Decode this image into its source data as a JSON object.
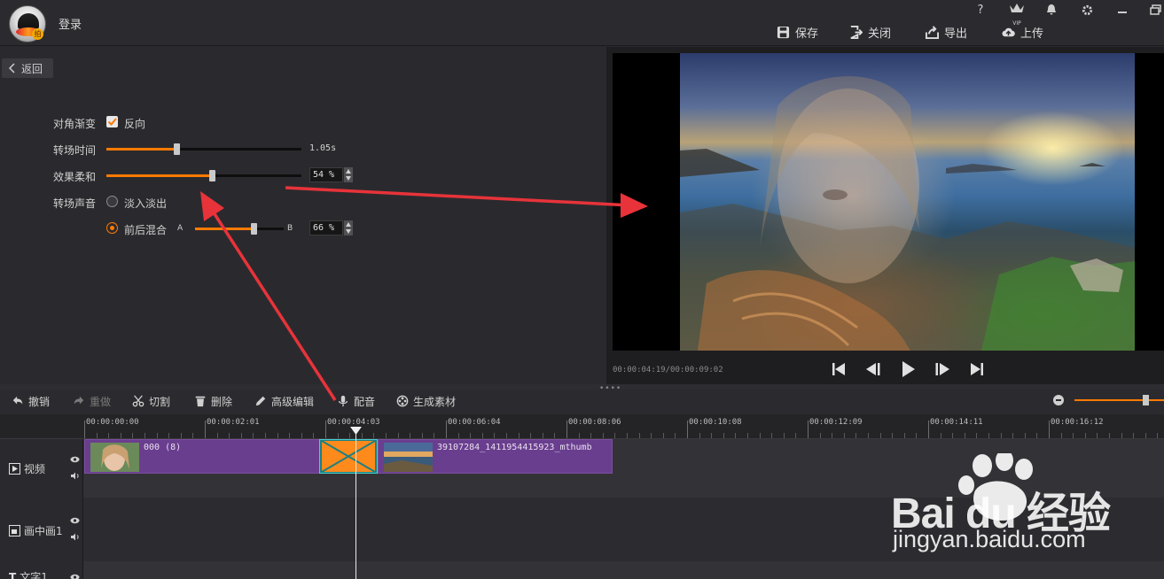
{
  "topbar": {
    "login": "登录",
    "help": "?",
    "vip": "VIP",
    "buttons": [
      {
        "label": "保存",
        "icon": "save-icon"
      },
      {
        "label": "关闭",
        "icon": "exit-icon"
      },
      {
        "label": "导出",
        "icon": "export-icon"
      },
      {
        "label": "上传",
        "icon": "upload-cloud-icon"
      }
    ]
  },
  "settings": {
    "back": "返回",
    "diagonal_label": "对角渐变",
    "reverse_label": "反向",
    "reverse_checked": true,
    "duration_label": "转场时间",
    "duration_value": "1.05s",
    "duration_fraction": 0.36,
    "softness_label": "效果柔和",
    "softness_value": "54 %",
    "softness_fraction": 0.54,
    "sound_label": "转场声音",
    "fade_label": "淡入淡出",
    "mix_label": "前后混合",
    "mix_a": "A",
    "mix_b": "B",
    "mix_value": "66 %",
    "mix_fraction": 0.66
  },
  "preview": {
    "timecode": "00:00:04:19/00:00:09:02",
    "controls": [
      "skip-back-icon",
      "step-back-icon",
      "play-icon",
      "step-forward-icon",
      "skip-forward-icon"
    ]
  },
  "edit_toolbar": {
    "undo": "撤销",
    "redo": "重做",
    "cut": "切割",
    "delete": "删除",
    "advanced": "高级编辑",
    "dub": "配音",
    "generate": "生成素材"
  },
  "ruler": {
    "labels": [
      "00:00:00:00",
      "00:00:02:01",
      "00:00:04:03",
      "00:00:06:04",
      "00:00:08:06",
      "00:00:10:08",
      "00:00:12:09",
      "00:00:14:11",
      "00:00:16:12"
    ]
  },
  "tracks": [
    {
      "name": "视频"
    },
    {
      "name": "画中画1"
    },
    {
      "name": "文字1"
    }
  ],
  "clips": {
    "clip1": "000 (8)",
    "clip2": "39107284_1411954415923_mthumb"
  },
  "watermark": {
    "brand": "Bai du 经验",
    "url": "jingyan.baidu.com"
  },
  "colors": {
    "accent": "#ff7a00",
    "clip": "#6a3e8e",
    "annotation_arrow": "#e8333a"
  }
}
